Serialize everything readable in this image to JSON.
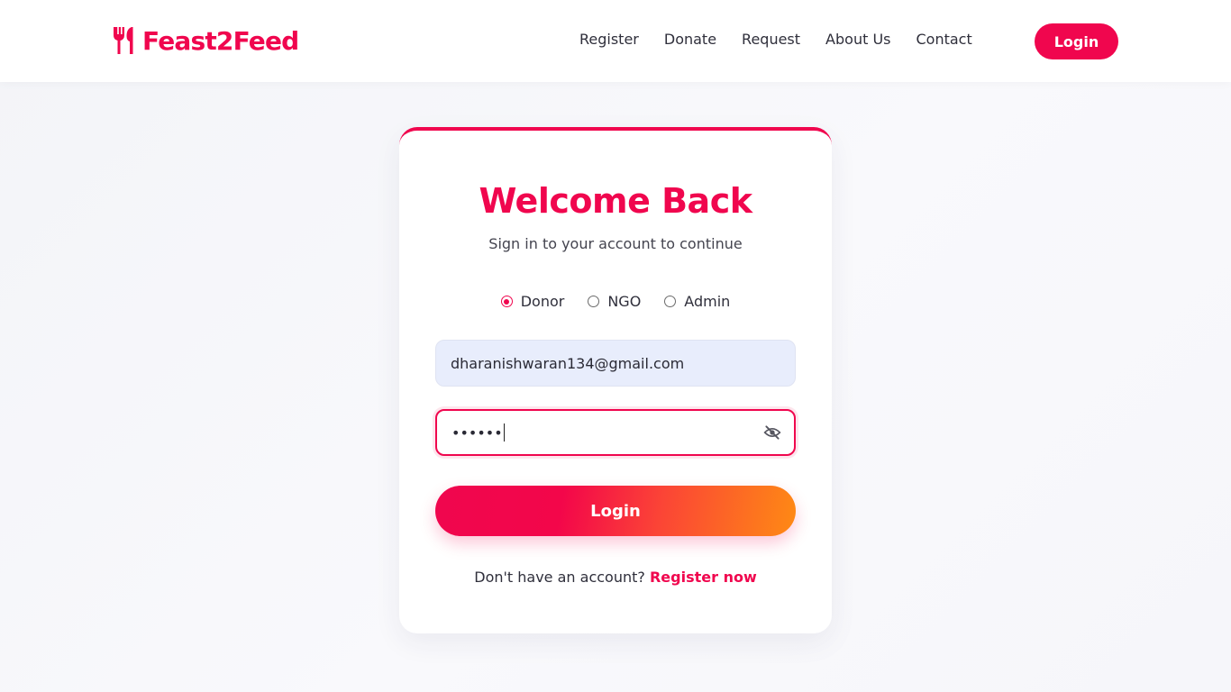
{
  "brand": {
    "name": "Feast2Feed",
    "icon": "fork-spoon-icon",
    "color": "#f0064e"
  },
  "nav": {
    "links": [
      {
        "label": "Register"
      },
      {
        "label": "Donate"
      },
      {
        "label": "Request"
      },
      {
        "label": "About Us"
      },
      {
        "label": "Contact"
      }
    ],
    "login_label": "Login"
  },
  "card": {
    "title": "Welcome Back",
    "subtitle": "Sign in to your account to continue",
    "roles": [
      {
        "label": "Donor",
        "checked": true
      },
      {
        "label": "NGO",
        "checked": false
      },
      {
        "label": "Admin",
        "checked": false
      }
    ],
    "email": {
      "value": "dharanishwaran134@gmail.com"
    },
    "password": {
      "masked_value": "••••••",
      "toggle_icon": "eye-off-icon"
    },
    "login_label": "Login",
    "register_prompt": "Don't have an account?",
    "register_link": "Register now"
  },
  "colors": {
    "accent": "#f0064e",
    "gradient_end": "#fe8a14",
    "email_bg": "#e8edfc"
  }
}
